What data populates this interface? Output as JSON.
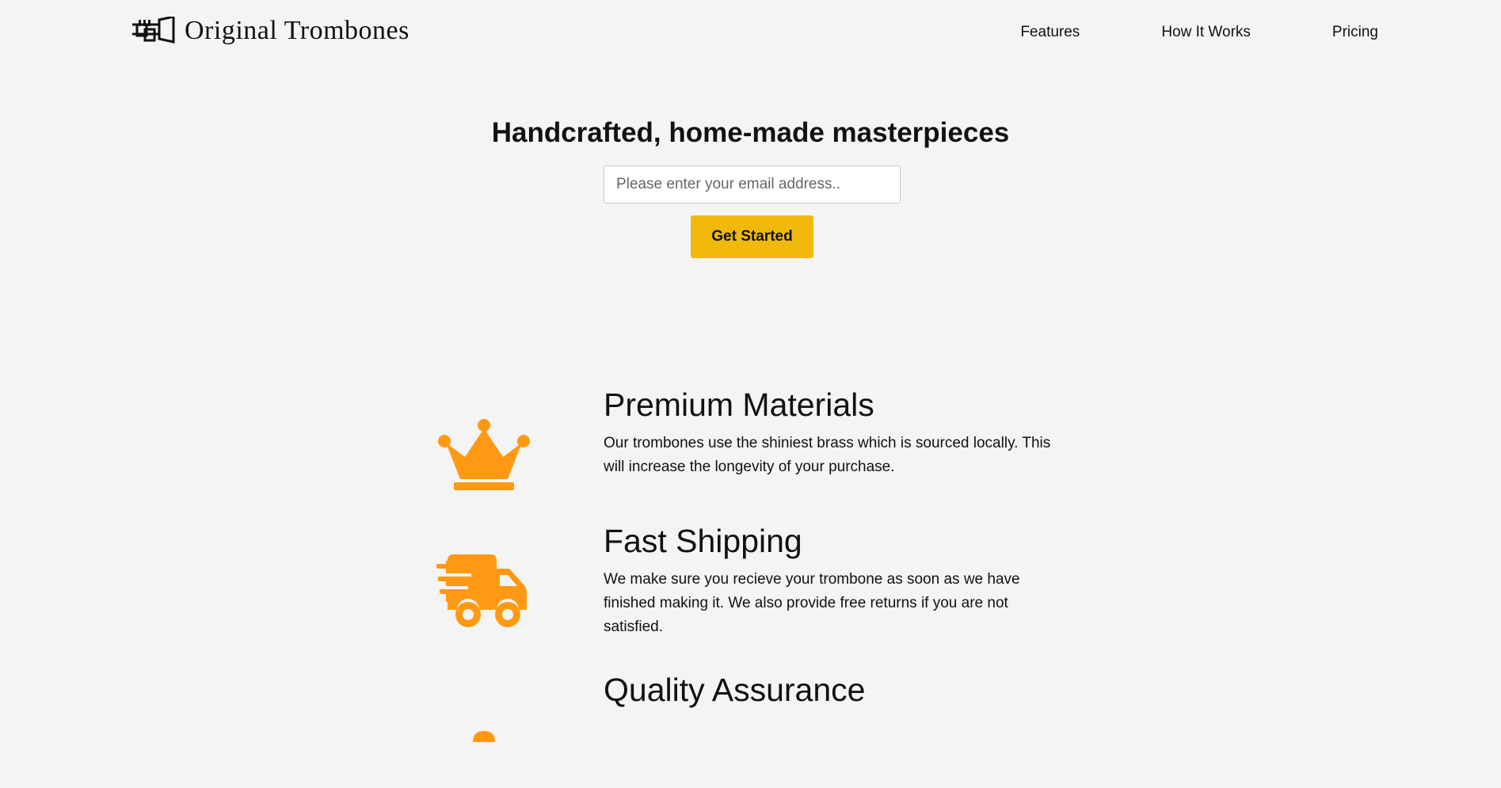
{
  "header": {
    "logo_text": "Original Trombones",
    "logo_icon": "trombone-icon",
    "nav": [
      {
        "label": "Features"
      },
      {
        "label": "How It Works"
      },
      {
        "label": "Pricing"
      }
    ]
  },
  "hero": {
    "title": "Handcrafted, home-made masterpieces",
    "email_placeholder": "Please enter your email address..",
    "cta_label": "Get Started"
  },
  "features": [
    {
      "icon": "crown-icon",
      "title": "Premium Materials",
      "description": "Our trombones use the shiniest brass which is sourced locally. This will increase the longevity of your purchase."
    },
    {
      "icon": "shipping-truck-icon",
      "title": "Fast Shipping",
      "description": "We make sure you recieve your trombone as soon as we have finished making it. We also provide free returns if you are not satisfied."
    },
    {
      "icon": "quality-assurance-icon",
      "title": "Quality Assurance",
      "description": ""
    }
  ],
  "colors": {
    "background": "#f4f4f4",
    "accent_button": "#f0b90b",
    "icon_orange": "#ff9914",
    "text": "#111111"
  }
}
